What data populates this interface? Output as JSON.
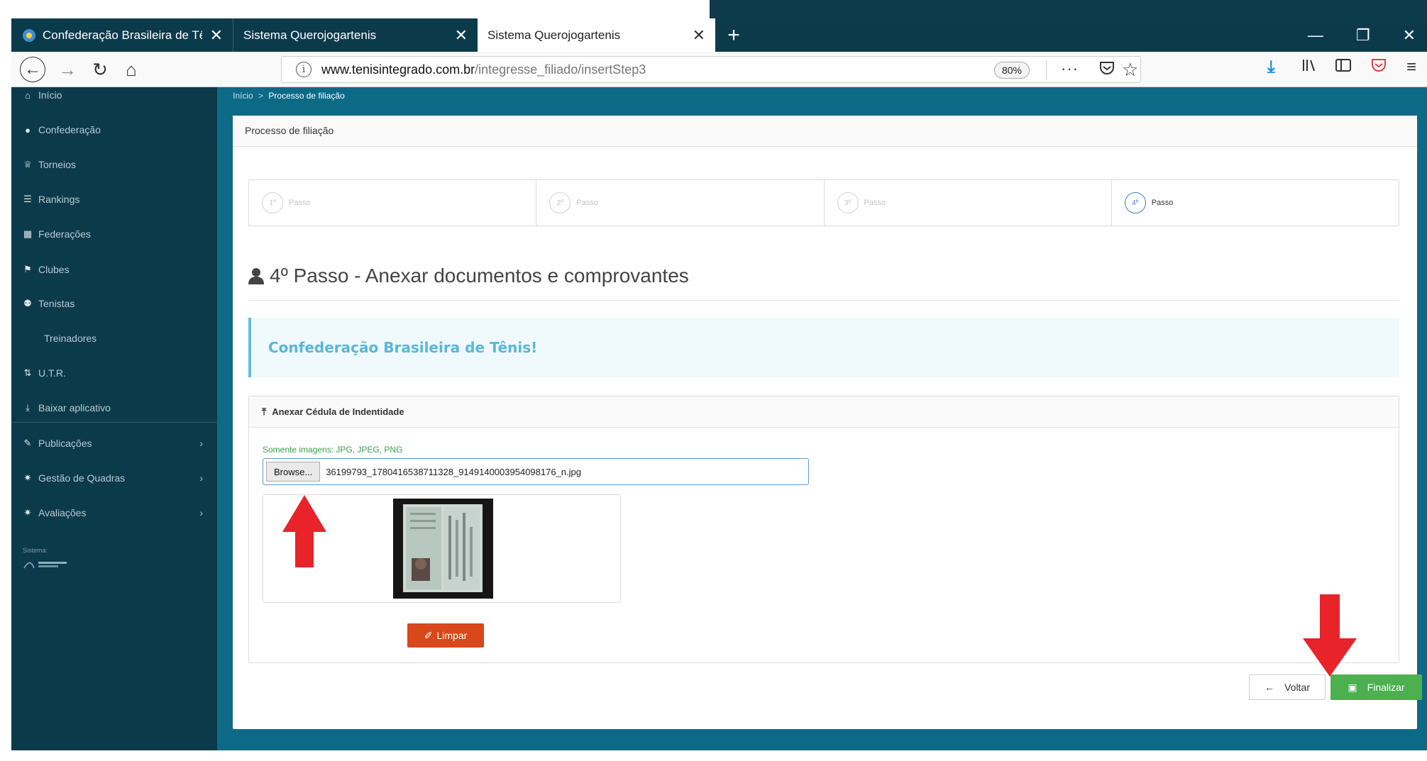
{
  "browser": {
    "tabs": [
      {
        "title": "Confederação Brasileira de Tênis",
        "active": false
      },
      {
        "title": "Sistema Querojogartenis",
        "active": false
      },
      {
        "title": "Sistema Querojogartenis",
        "active": true
      }
    ],
    "url_domain": "www.tenisintegrado.com.br",
    "url_path": "/integresse_filiado/insertStep3",
    "zoom": "80%",
    "page_actions": "···"
  },
  "sidebar": {
    "items": [
      {
        "label": "Início",
        "icon": "home-icon"
      },
      {
        "label": "Confederação",
        "icon": "globe-icon"
      },
      {
        "label": "Torneios",
        "icon": "trophy-icon"
      },
      {
        "label": "Rankings",
        "icon": "list-icon"
      },
      {
        "label": "Federações",
        "icon": "bank-icon"
      },
      {
        "label": "Clubes",
        "icon": "flag-icon"
      },
      {
        "label": "Tenistas",
        "icon": "users-icon"
      },
      {
        "label": "Treinadores",
        "icon": ""
      },
      {
        "label": "U.T.R.",
        "icon": "sort-icon"
      },
      {
        "label": "Baixar aplicativo",
        "icon": "download-icon"
      },
      {
        "label": "Publicações",
        "icon": "edit-icon"
      },
      {
        "label": "Gestão de Quadras",
        "icon": "gear-icon"
      },
      {
        "label": "Avaliações",
        "icon": "gear-icon"
      }
    ],
    "system_label": "Sistema:"
  },
  "breadcrumb": {
    "home": "Início",
    "separator": ">",
    "current": "Processo de filiação"
  },
  "card": {
    "header": "Processo de filiação"
  },
  "steps": [
    {
      "num": "1º",
      "label": "Passo",
      "active": false
    },
    {
      "num": "2º",
      "label": "Passo",
      "active": false
    },
    {
      "num": "3º",
      "label": "Passo",
      "active": false
    },
    {
      "num": "4º",
      "label": "Passo",
      "active": true
    }
  ],
  "section_title": "4º Passo - Anexar documentos e comprovantes",
  "alert_text": "Confederação Brasileira de Tênis!",
  "upload": {
    "title": "Anexar Cédula de Indentidade",
    "hint": "Somente imagens: JPG, JPEG, PNG",
    "browse_label": "Browse...",
    "file_name": "36199793_1780416538711328_9149140003954098176_n.jpg",
    "clear_label": "Limpar"
  },
  "actions": {
    "back_label": "Voltar",
    "finish_label": "Finalizar"
  },
  "colors": {
    "sidebar": "#0b3a4b",
    "page_bg": "#0d6a87",
    "finish": "#4caf50",
    "clear": "#d9481b",
    "arrow": "#e8232a",
    "info": "#5bc0de"
  }
}
